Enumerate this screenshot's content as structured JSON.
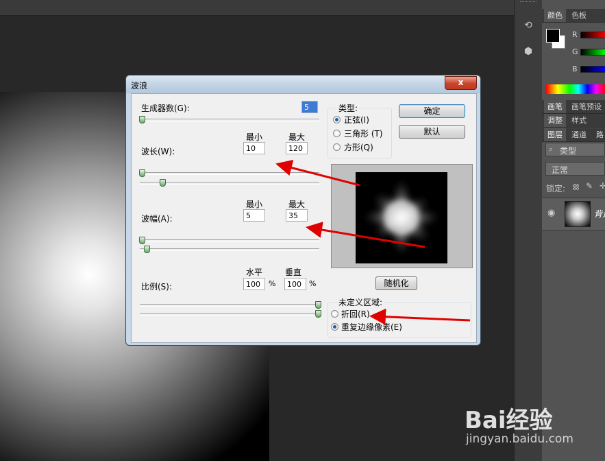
{
  "dialog": {
    "title": "波浪",
    "close_label": "x",
    "generators": {
      "label": "生成器数(G):",
      "value": "5"
    },
    "wavelength": {
      "label": "波长(W):",
      "min_label": "最小",
      "max_label": "最大",
      "min": "10",
      "max": "120"
    },
    "amplitude": {
      "label": "波幅(A):",
      "min_label": "最小",
      "max_label": "最大",
      "min": "5",
      "max": "35"
    },
    "scale": {
      "label": "比例(S):",
      "h_label": "水平",
      "v_label": "垂直",
      "h": "100",
      "v": "100",
      "unit": "%"
    },
    "type": {
      "legend": "类型:",
      "options": [
        {
          "label": "正弦(I)",
          "checked": true
        },
        {
          "label": "三角形 (T)",
          "checked": false
        },
        {
          "label": "方形(Q)",
          "checked": false
        }
      ]
    },
    "ok_label": "确定",
    "cancel_label": "默认",
    "randomize_label": "随机化",
    "undefined_area": {
      "legend": "未定义区域:",
      "options": [
        {
          "label": "折回(R)",
          "checked": false
        },
        {
          "label": "重复边缘像素(E)",
          "checked": true
        }
      ]
    }
  },
  "panel": {
    "color_tabs": [
      "颜色",
      "色板"
    ],
    "channels": [
      "R",
      "G",
      "B"
    ],
    "brush_tabs": [
      "画笔",
      "画笔预设"
    ],
    "adjust_tabs": [
      "调整",
      "样式"
    ],
    "layer_tabs": [
      "图层",
      "通道",
      "路"
    ],
    "kind_label": "类型",
    "blend_mode": "正常",
    "lock_label": "锁定:",
    "layer_name": "背景"
  },
  "watermark": {
    "logo": "Bai经验",
    "url": "jingyan.baidu.com"
  },
  "colors": {
    "dialog_frame": "#c7d7e8",
    "annotation_arrow": "#e00000",
    "workspace": "#282828",
    "panel": "#535353"
  },
  "icons": [
    "history-icon",
    "3d-icon",
    "eye-icon",
    "search-icon",
    "lock-pixels-icon",
    "brush-icon",
    "move-icon"
  ]
}
